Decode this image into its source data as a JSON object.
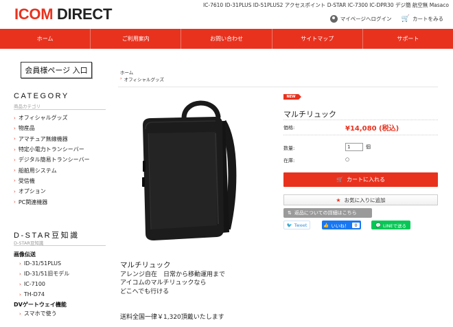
{
  "header": {
    "logo_icom": "ICOM",
    "logo_direct": " DIRECT",
    "topline": "IC-7610  ID-31PLUS  ID-51PLUS2  アクセスポイント  D-STAR  IC-7300  IC-DPR30  デジ簡 航空無 Masaco",
    "mypage_label": "マイページへログイン",
    "cart_label": "カートをみる"
  },
  "nav": {
    "items": [
      "ホーム",
      "ご利用案内",
      "お問い合わせ",
      "サイトマップ",
      "サポート"
    ]
  },
  "sidebar": {
    "member_button": "会員様ページ 入口",
    "category_heading": "CATEGORY",
    "category_sub": "商品カテゴリ",
    "categories": [
      "オフィシャルグッズ",
      "物産品",
      "アマチュア無線機器",
      "特定小電力トランシーバー",
      "デジタル簡易トランシーバー",
      "船舶用システム",
      "受信機",
      "オプション",
      "PC関連機器"
    ],
    "dstar_heading": "D-STAR豆知識",
    "dstar_sub": "D-STAR豆知識",
    "group1_title": "画像伝送",
    "group1_items": [
      "ID-31/51PLUS",
      "ID-31/51旧モデル",
      "IC-7100",
      "TH-D74"
    ],
    "group2_title": "DVゲートウェイ機能",
    "group2_items": [
      "スマホで使う"
    ]
  },
  "breadcrumb": {
    "home": "ホーム",
    "current": "オフィシャルグッズ"
  },
  "product": {
    "badge": "NEW",
    "name": "マルチリュック",
    "price_label": "価格:",
    "price": "¥14,080 (税込)",
    "qty_label": "数量:",
    "qty_value": "1",
    "qty_unit": "個",
    "stock_label": "在庫:",
    "stock_value": "○",
    "cart_button": "カートに入れる",
    "fav_button": "お気に入りに追加",
    "inquiry_button": "返品についての詳細はこちら",
    "tweet": "Tweet",
    "fb_label": "いいね！",
    "fb_count": "0",
    "line_label": "LINEで送る"
  },
  "description": {
    "title": "マルチリュック",
    "lines": [
      "アレンジ自在　日常から移動運用まで",
      "アイコムのマルチリュックなら",
      "どこへでも行ける"
    ],
    "shipping": "送料全国一律￥1,320頂戴いたします"
  },
  "colors": {
    "accent": "#e8321e",
    "fb": "#1877f2",
    "line": "#06c755"
  }
}
